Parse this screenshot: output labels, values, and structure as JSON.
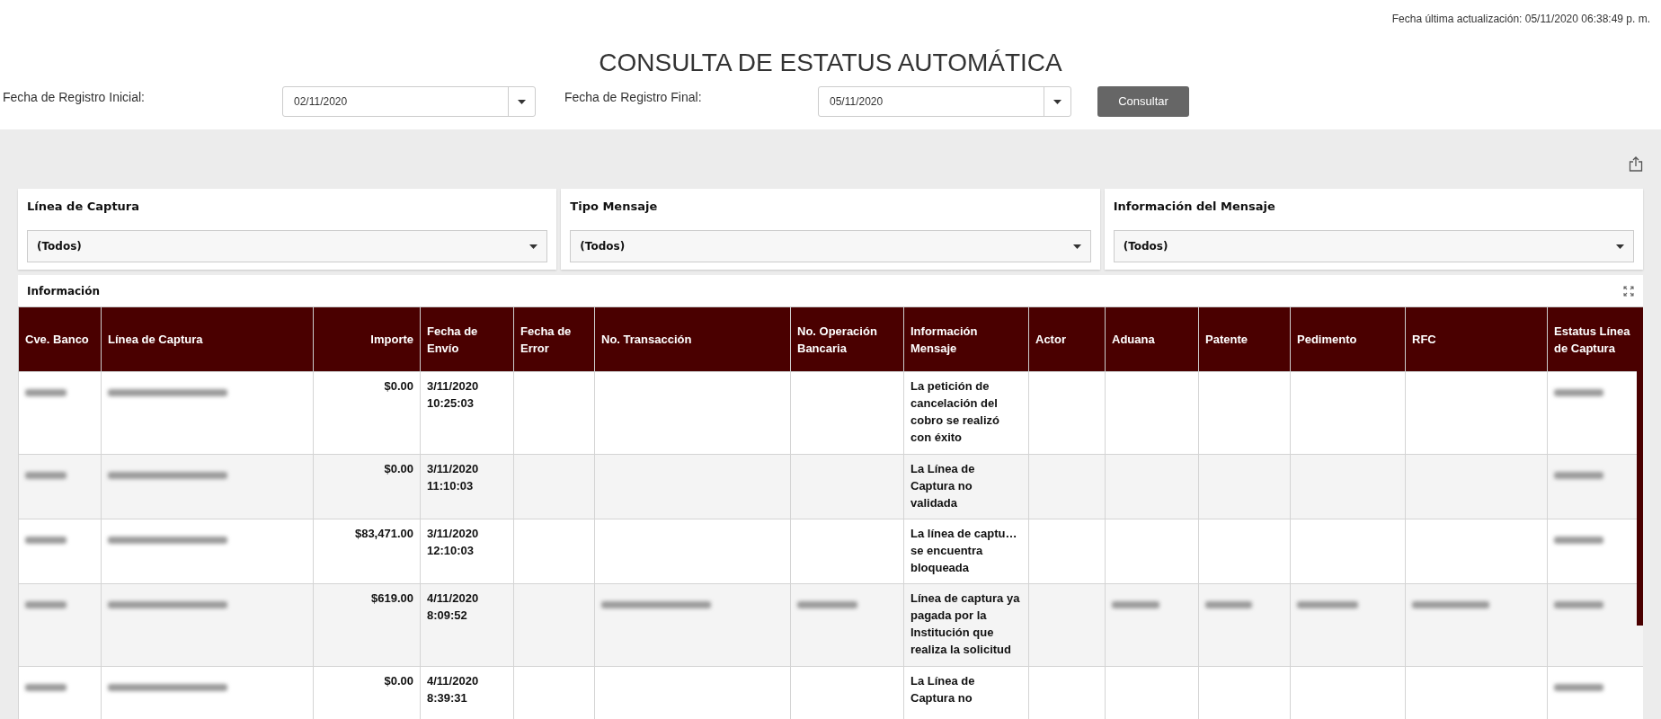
{
  "last_update": "Fecha última actualización: 05/11/2020 06:38:49 p. m.",
  "title": "CONSULTA DE ESTATUS AUTOMÁTICA",
  "date_filters": [
    {
      "label": "Fecha de Registro Inicial:",
      "value": "02/11/2020"
    },
    {
      "label": "Fecha de Registro Final:",
      "value": "05/11/2020"
    }
  ],
  "query_button": "Consultar",
  "dropdown_filters": [
    {
      "label": "Línea de Captura",
      "value": "(Todos)"
    },
    {
      "label": "Tipo Mensaje",
      "value": "(Todos)"
    },
    {
      "label": "Información del Mensaje",
      "value": "(Todos)"
    }
  ],
  "table": {
    "title": "Información",
    "columns": [
      "Cve. Banco",
      "Línea de Captura",
      "Importe",
      "Fecha de Envío",
      "Fecha de Error",
      "No. Transacción",
      "No. Operación Bancaria",
      "Información Mensaje",
      "Actor",
      "Aduana",
      "Patente",
      "Pedimento",
      "RFC",
      "Estatus Línea de Captura"
    ],
    "rows": [
      {
        "cells": [
          {
            "kind": "blurred"
          },
          {
            "kind": "blurred"
          },
          {
            "kind": "text",
            "text": "$0.00"
          },
          {
            "kind": "text",
            "text": "3/11/2020 10:25:03"
          },
          {
            "kind": "empty"
          },
          {
            "kind": "empty"
          },
          {
            "kind": "empty"
          },
          {
            "kind": "text",
            "text": "La petición de cancelación del cobro se realizó con éxito"
          },
          {
            "kind": "empty"
          },
          {
            "kind": "empty"
          },
          {
            "kind": "empty"
          },
          {
            "kind": "empty"
          },
          {
            "kind": "empty"
          },
          {
            "kind": "blurred"
          }
        ]
      },
      {
        "cells": [
          {
            "kind": "blurred"
          },
          {
            "kind": "blurred"
          },
          {
            "kind": "text",
            "text": "$0.00"
          },
          {
            "kind": "text",
            "text": "3/11/2020 11:10:03"
          },
          {
            "kind": "empty"
          },
          {
            "kind": "empty"
          },
          {
            "kind": "empty"
          },
          {
            "kind": "text",
            "text": "La Línea de Captura no validada"
          },
          {
            "kind": "empty"
          },
          {
            "kind": "empty"
          },
          {
            "kind": "empty"
          },
          {
            "kind": "empty"
          },
          {
            "kind": "empty"
          },
          {
            "kind": "blurred"
          }
        ]
      },
      {
        "cells": [
          {
            "kind": "blurred"
          },
          {
            "kind": "blurred"
          },
          {
            "kind": "text",
            "text": "$83,471.00"
          },
          {
            "kind": "text",
            "text": "3/11/2020 12:10:03"
          },
          {
            "kind": "empty"
          },
          {
            "kind": "empty"
          },
          {
            "kind": "empty"
          },
          {
            "kind": "text",
            "text": "La línea de captu… se encuentra bloqueada"
          },
          {
            "kind": "empty"
          },
          {
            "kind": "empty"
          },
          {
            "kind": "empty"
          },
          {
            "kind": "empty"
          },
          {
            "kind": "empty"
          },
          {
            "kind": "blurred"
          }
        ]
      },
      {
        "cells": [
          {
            "kind": "blurred"
          },
          {
            "kind": "blurred"
          },
          {
            "kind": "text",
            "text": "$619.00"
          },
          {
            "kind": "text",
            "text": "4/11/2020 8:09:52"
          },
          {
            "kind": "empty"
          },
          {
            "kind": "blurred"
          },
          {
            "kind": "blurred"
          },
          {
            "kind": "text",
            "text": "Línea de captura ya pagada por la Institución que realiza la solicitud"
          },
          {
            "kind": "empty"
          },
          {
            "kind": "blurred"
          },
          {
            "kind": "blurred"
          },
          {
            "kind": "blurred"
          },
          {
            "kind": "blurred"
          },
          {
            "kind": "blurred"
          }
        ]
      },
      {
        "cells": [
          {
            "kind": "blurred"
          },
          {
            "kind": "blurred"
          },
          {
            "kind": "text",
            "text": "$0.00"
          },
          {
            "kind": "text",
            "text": "4/11/2020 8:39:31"
          },
          {
            "kind": "empty"
          },
          {
            "kind": "empty"
          },
          {
            "kind": "empty"
          },
          {
            "kind": "text",
            "text": "La Línea de Captura no"
          },
          {
            "kind": "empty"
          },
          {
            "kind": "empty"
          },
          {
            "kind": "empty"
          },
          {
            "kind": "empty"
          },
          {
            "kind": "empty"
          },
          {
            "kind": "blurred"
          }
        ]
      }
    ]
  }
}
